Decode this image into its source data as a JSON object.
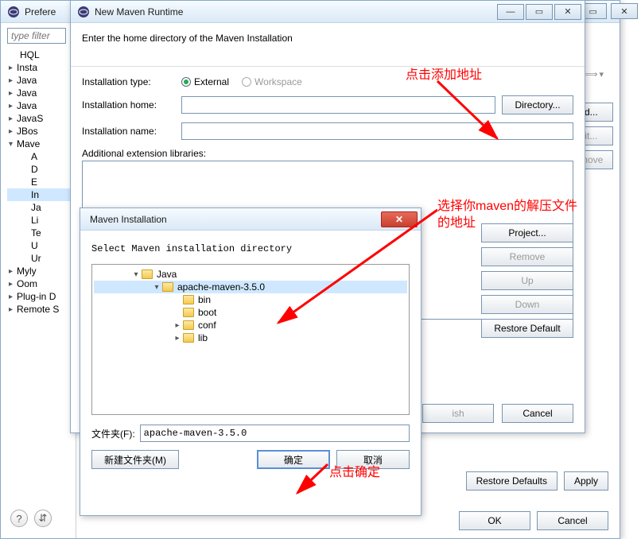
{
  "pref": {
    "title": "Prefere",
    "filter_placeholder": "type filter",
    "tree": [
      "HQL",
      "Insta",
      "Java",
      "Java",
      "Java",
      "JavaS",
      "JBos",
      "Mave"
    ],
    "tree_sub": [
      "A",
      "D",
      "E",
      "In",
      "Ja",
      "Li",
      "Te",
      "U",
      "Ur"
    ],
    "tree_after": [
      "Myly",
      "Oom",
      "Plug-in D",
      "Remote S"
    ],
    "right_buttons": {
      "add": "Add...",
      "edit": "Edit...",
      "remove": "Remove"
    },
    "footer": {
      "restore": "Restore Defaults",
      "apply": "Apply",
      "ok": "OK",
      "cancel": "Cancel"
    }
  },
  "nmr": {
    "title": "New Maven Runtime",
    "heading": "Enter the home directory of the Maven Installation",
    "labels": {
      "type": "Installation type:",
      "home": "Installation home:",
      "name": "Installation name:",
      "ext": "Additional extension libraries:"
    },
    "type_opts": {
      "external": "External",
      "workspace": "Workspace"
    },
    "dir_btn": "Directory...",
    "side": {
      "project": "Project...",
      "remove": "Remove",
      "up": "Up",
      "down": "Down",
      "restore": "Restore Default"
    },
    "footer": {
      "finish": "ish",
      "cancel": "Cancel"
    }
  },
  "browse": {
    "title": "Maven Installation",
    "prompt": "Select Maven installation directory",
    "tree": [
      {
        "name": "Java",
        "depth": 1,
        "caret": "▾",
        "sel": false
      },
      {
        "name": "apache-maven-3.5.0",
        "depth": 2,
        "caret": "▾",
        "sel": true
      },
      {
        "name": "bin",
        "depth": 3,
        "caret": "",
        "sel": false
      },
      {
        "name": "boot",
        "depth": 3,
        "caret": "",
        "sel": false
      },
      {
        "name": "conf",
        "depth": 3,
        "caret": "▸",
        "sel": false
      },
      {
        "name": "lib",
        "depth": 3,
        "caret": "▸",
        "sel": false
      }
    ],
    "path_label": "文件夹(F):",
    "path_value": "apache-maven-3.5.0",
    "buttons": {
      "newf": "新建文件夹(M)",
      "ok": "确定",
      "cancel": "取消"
    }
  },
  "annot": {
    "a1": "点击添加地址",
    "a2": "选择你maven的解压文件的地址",
    "a3": "点击确定"
  }
}
